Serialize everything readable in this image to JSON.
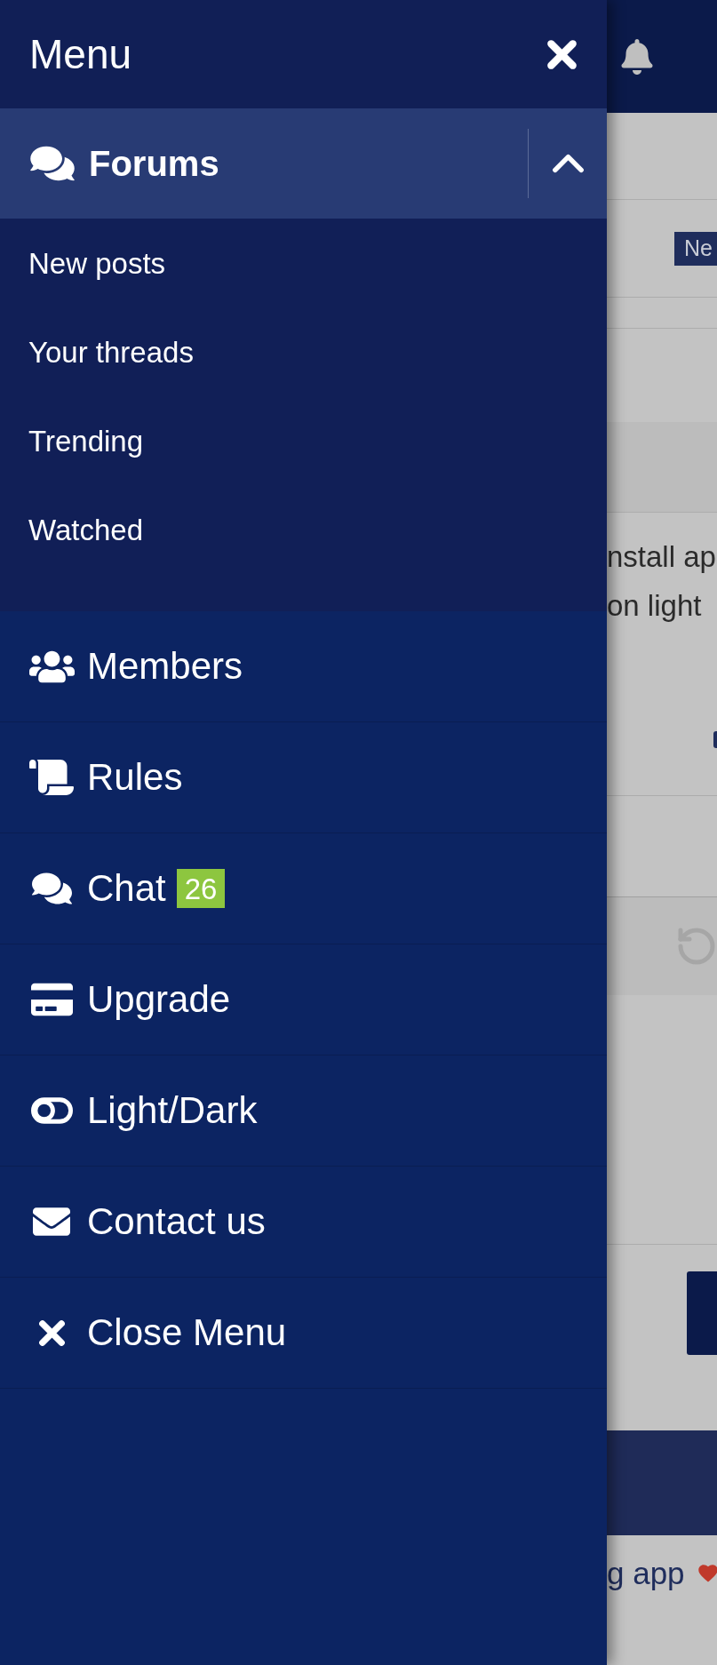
{
  "menu": {
    "title": "Menu"
  },
  "forums": {
    "label": "Forums",
    "expanded": true,
    "children": [
      {
        "label": "New posts"
      },
      {
        "label": "Your threads"
      },
      {
        "label": "Trending"
      },
      {
        "label": "Watched"
      }
    ]
  },
  "items": [
    {
      "label": "Members"
    },
    {
      "label": "Rules"
    },
    {
      "label": "Chat",
      "badge": "26"
    },
    {
      "label": "Upgrade"
    },
    {
      "label": "Light/Dark"
    },
    {
      "label": "Contact us"
    },
    {
      "label": "Close Menu"
    }
  ],
  "background_page": {
    "badge": "Ne",
    "text_lines": [
      "nstall ap",
      "on light"
    ],
    "title_fragment": "g app"
  }
}
